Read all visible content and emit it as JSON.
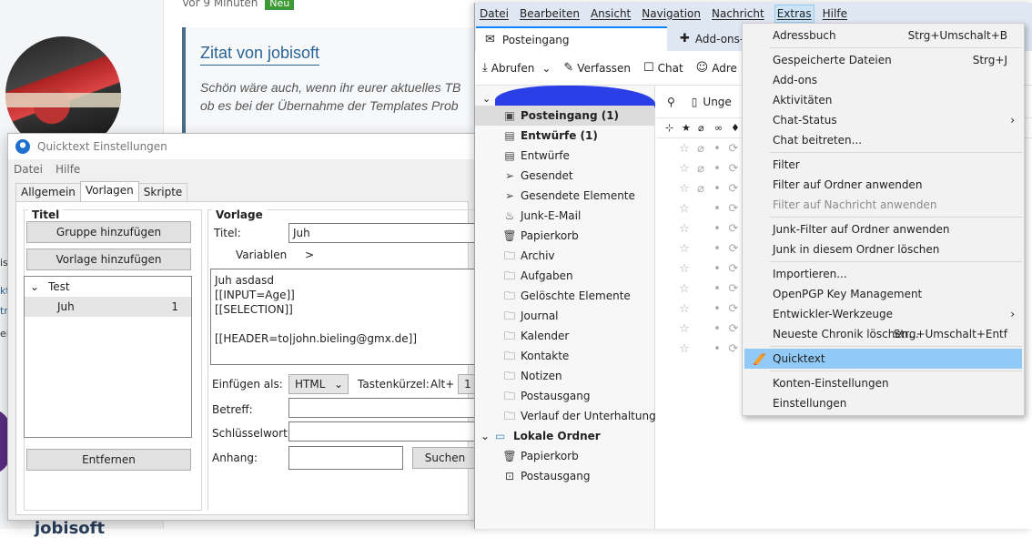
{
  "forum": {
    "meta_time": "Vor 9 Minuten",
    "badge": "Neu",
    "quote_title": "Zitat von jobisoft",
    "quote_line1": "Schön wäre auch, wenn ihr eurer aktuelles TB",
    "quote_line2": "ob es bei der Übernahme der Templates Prob",
    "side_fragments": [
      "is",
      "kt",
      "trä",
      "ei"
    ],
    "bottom_name": "jobisoft"
  },
  "quicktext": {
    "title": "Quicktext Einstellungen",
    "menu": [
      "Datei",
      "Hilfe"
    ],
    "tabs": [
      "Allgemein",
      "Vorlagen",
      "Skripte"
    ],
    "titel_group": "Titel",
    "btn_add_group": "Gruppe hinzufügen",
    "btn_add_template": "Vorlage hinzufügen",
    "tree_group": "Test",
    "tree_item": "Juh",
    "tree_item_count": "1",
    "btn_remove": "Entfernen",
    "vorlage_group": "Vorlage",
    "label_title": "Titel:",
    "title_value": "Juh",
    "label_variables": "Variablen",
    "variables_arrow": ">",
    "template_text": "Juh asdasd\n[[INPUT=Age]]\n[[SELECTION]]\n\n[[HEADER=to|john.bieling@gmx.de]]",
    "label_insert_as": "Einfügen als:",
    "insert_as_value": "HTML",
    "label_shortcut": "Tastenkürzel:",
    "shortcut_mod": "Alt+",
    "shortcut_value": "1",
    "label_subject": "Betreff:",
    "label_keyword": "Schlüsselwort:",
    "label_attachment": "Anhang:",
    "btn_search": "Suchen"
  },
  "thunderbird": {
    "menubar": [
      "Datei",
      "Bearbeiten",
      "Ansicht",
      "Navigation",
      "Nachricht",
      "Extras",
      "Hilfe"
    ],
    "tab_inbox": "Posteingang",
    "tab_addons": "Add-ons-",
    "toolbar": {
      "fetch": "Abrufen",
      "compose": "Verfassen",
      "chat": "Chat",
      "address": "Adre"
    },
    "msg_toolbar_unread": "Unge",
    "folders": [
      {
        "icon": "inbox-icon",
        "glyph": "▣",
        "label": "Posteingang (1)",
        "bold": true,
        "selected": true
      },
      {
        "icon": "drafts-icon",
        "glyph": "▤",
        "label": "Entwürfe (1)",
        "bold": true
      },
      {
        "icon": "drafts-icon",
        "glyph": "▤",
        "label": "Entwürfe"
      },
      {
        "icon": "sent-icon",
        "glyph": "➢",
        "label": "Gesendet"
      },
      {
        "icon": "sent-icon",
        "glyph": "➢",
        "label": "Gesendete Elemente"
      },
      {
        "icon": "junk-icon",
        "glyph": "♨",
        "label": "Junk-E-Mail"
      },
      {
        "icon": "trash-icon",
        "glyph": "🗑",
        "label": "Papierkorb"
      },
      {
        "icon": "folder-icon",
        "glyph": "🗀",
        "label": "Archiv"
      },
      {
        "icon": "folder-icon",
        "glyph": "🗀",
        "label": "Aufgaben"
      },
      {
        "icon": "folder-icon",
        "glyph": "🗀",
        "label": "Gelöschte Elemente"
      },
      {
        "icon": "folder-icon",
        "glyph": "🗀",
        "label": "Journal"
      },
      {
        "icon": "folder-icon",
        "glyph": "🗀",
        "label": "Kalender"
      },
      {
        "icon": "folder-icon",
        "glyph": "🗀",
        "label": "Kontakte"
      },
      {
        "icon": "folder-icon",
        "glyph": "🗀",
        "label": "Notizen"
      },
      {
        "icon": "folder-icon",
        "glyph": "🗀",
        "label": "Postausgang"
      },
      {
        "icon": "folder-icon",
        "glyph": "🗀",
        "label": "Verlauf der Unterhaltung"
      }
    ],
    "local_folders": "Lokale Ordner",
    "local_items": [
      {
        "icon": "trash-icon",
        "glyph": "🗑",
        "label": "Papierkorb"
      },
      {
        "icon": "outbox-icon",
        "glyph": "⊡",
        "label": "Postausgang"
      }
    ]
  },
  "extras_menu": {
    "items": [
      {
        "type": "item",
        "label": "Adressbuch",
        "shortcut": "Strg+Umschalt+B"
      },
      {
        "type": "sep"
      },
      {
        "type": "item",
        "label": "Gespeicherte Dateien",
        "shortcut": "Strg+J"
      },
      {
        "type": "item",
        "label": "Add-ons"
      },
      {
        "type": "item",
        "label": "Aktivitäten"
      },
      {
        "type": "item",
        "label": "Chat-Status",
        "submenu": true
      },
      {
        "type": "item",
        "label": "Chat beitreten..."
      },
      {
        "type": "sep"
      },
      {
        "type": "item",
        "label": "Filter"
      },
      {
        "type": "item",
        "label": "Filter auf Ordner anwenden"
      },
      {
        "type": "item",
        "label": "Filter auf Nachricht anwenden",
        "disabled": true
      },
      {
        "type": "sep"
      },
      {
        "type": "item",
        "label": "Junk-Filter auf Ordner anwenden"
      },
      {
        "type": "item",
        "label": "Junk in diesem Ordner löschen"
      },
      {
        "type": "sep"
      },
      {
        "type": "item",
        "label": "Importieren..."
      },
      {
        "type": "item",
        "label": "OpenPGP Key Management"
      },
      {
        "type": "item",
        "label": "Entwickler-Werkzeuge",
        "submenu": true
      },
      {
        "type": "item",
        "label": "Neueste Chronik löschen...",
        "shortcut": "Strg+Umschalt+Entf"
      },
      {
        "type": "sep"
      },
      {
        "type": "item",
        "label": "Quicktext",
        "highlighted": true,
        "icon": true
      },
      {
        "type": "sep"
      },
      {
        "type": "item",
        "label": "Konten-Einstellungen"
      },
      {
        "type": "item",
        "label": "Einstellungen"
      }
    ]
  },
  "colors": {
    "menu_highlight": "#91c9f7",
    "tb_menubar": "#dfe7f3",
    "active_tab_accent": "#0a84ff",
    "scribble": "#2b3fe6",
    "forum_badge": "#3d9b35",
    "quote_title": "#2a6496"
  }
}
